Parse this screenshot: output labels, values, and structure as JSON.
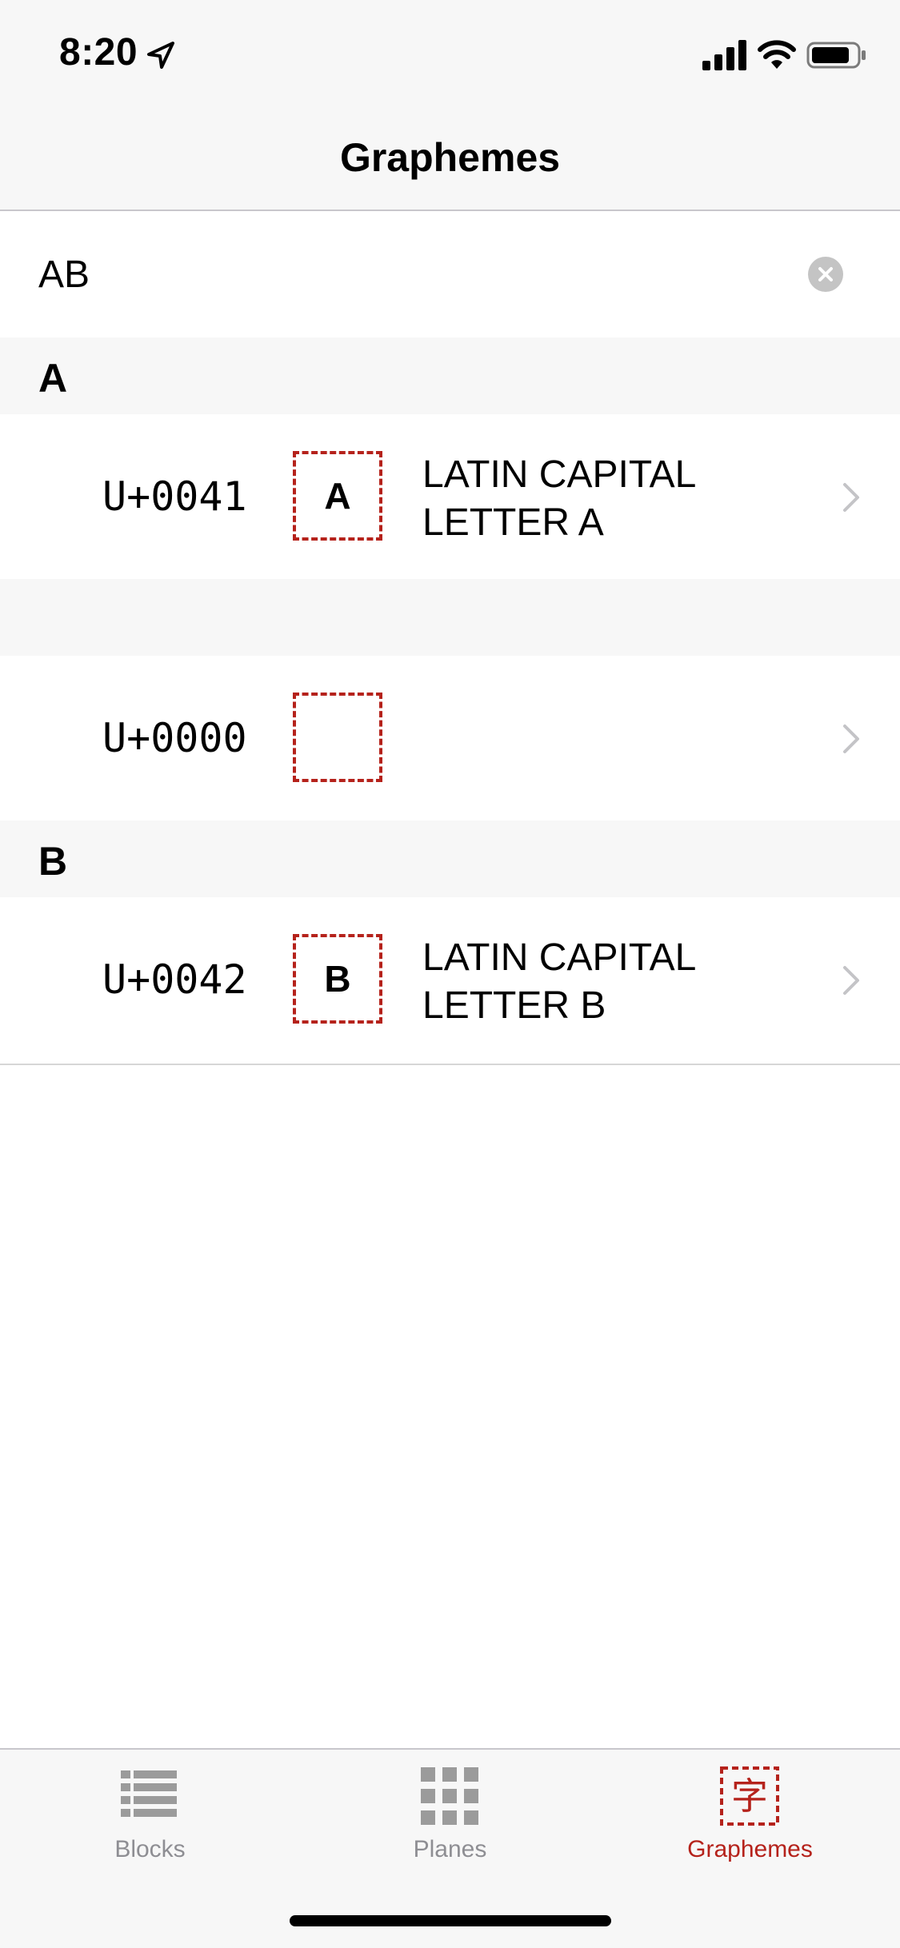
{
  "status_bar": {
    "time": "8:20",
    "icons": [
      "location-arrow-icon",
      "cellular-signal-icon",
      "wifi-icon",
      "battery-icon"
    ]
  },
  "nav": {
    "title": "Graphemes"
  },
  "search": {
    "value": "AB",
    "clear_icon": "clear-circle-icon"
  },
  "sections": [
    {
      "header": "A",
      "rows": [
        {
          "code": "U+0041",
          "glyph": "A",
          "name": "LATIN CAPITAL LETTER A"
        }
      ]
    },
    {
      "header": "",
      "rows": [
        {
          "code": "U+0000",
          "glyph": "",
          "name": ""
        }
      ]
    },
    {
      "header": "B",
      "rows": [
        {
          "code": "U+0042",
          "glyph": "B",
          "name": "LATIN CAPITAL LETTER B"
        }
      ]
    }
  ],
  "tab_bar": {
    "active_index": 2,
    "tabs": [
      {
        "label": "Blocks",
        "icon": "list-icon"
      },
      {
        "label": "Planes",
        "icon": "grid-icon"
      },
      {
        "label": "Graphemes",
        "icon": "grapheme-character-icon",
        "icon_glyph": "字"
      }
    ]
  },
  "colors": {
    "accent": "#b5221b",
    "inactive": "#8e8e93",
    "background_gray": "#f7f7f7"
  }
}
